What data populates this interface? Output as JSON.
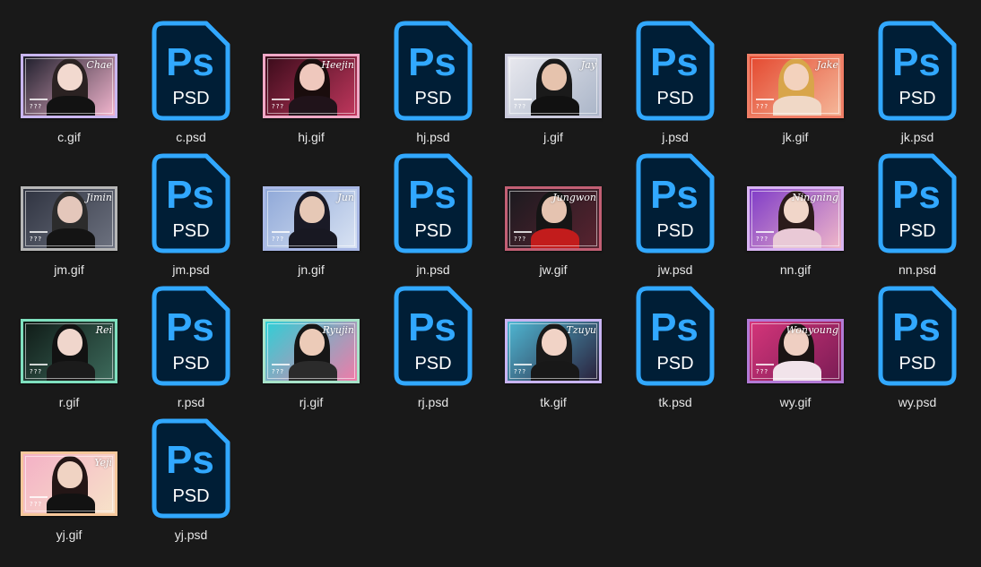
{
  "files": [
    {
      "name": "c.gif",
      "type": "gif",
      "script": "Chae",
      "frame": "#c9b6f0",
      "bg1": "#1d1d2a",
      "bg2": "#f3b6cf",
      "skin": "#f2d9cf",
      "hair": "#2b2222",
      "cloth": "#121212"
    },
    {
      "name": "c.psd",
      "type": "psd",
      "icon": "photoshop-psd-icon"
    },
    {
      "name": "hj.gif",
      "type": "gif",
      "script": "Heejin",
      "frame": "#f0a8c6",
      "bg1": "#3a0b1a",
      "bg2": "#c0375d",
      "skin": "#efc8bd",
      "hair": "#1a0d0d",
      "cloth": "#20131a"
    },
    {
      "name": "hj.psd",
      "type": "psd",
      "icon": "photoshop-psd-icon"
    },
    {
      "name": "j.gif",
      "type": "gif",
      "script": "Jay",
      "frame": "#c9c9dc",
      "bg1": "#e9e9ef",
      "bg2": "#aab5c8",
      "skin": "#e6c3ad",
      "hair": "#1a1a1a",
      "cloth": "#111111"
    },
    {
      "name": "j.psd",
      "type": "psd",
      "icon": "photoshop-psd-icon"
    },
    {
      "name": "jk.gif",
      "type": "gif",
      "script": "Jake",
      "frame": "#f07e66",
      "bg1": "#e4482f",
      "bg2": "#f5b89a",
      "skin": "#f3d2bd",
      "hair": "#d8a54a",
      "cloth": "#f0d8c6"
    },
    {
      "name": "jk.psd",
      "type": "psd",
      "icon": "photoshop-psd-icon"
    },
    {
      "name": "jm.gif",
      "type": "gif",
      "script": "Jimin",
      "frame": "#b7b7b7",
      "bg1": "#2f3340",
      "bg2": "#6d7280",
      "skin": "#e4c7bb",
      "hair": "#2c2c2c",
      "cloth": "#141414"
    },
    {
      "name": "jm.psd",
      "type": "psd",
      "icon": "photoshop-psd-icon"
    },
    {
      "name": "jn.gif",
      "type": "gif",
      "script": "Jun",
      "frame": "#a9b8e6",
      "bg1": "#8fa8d8",
      "bg2": "#d9e3f3",
      "skin": "#e6c8b6",
      "hair": "#1a1a26",
      "cloth": "#181822"
    },
    {
      "name": "jn.psd",
      "type": "psd",
      "icon": "photoshop-psd-icon"
    },
    {
      "name": "jw.gif",
      "type": "gif",
      "script": "Jungwon",
      "frame": "#c25f74",
      "bg1": "#1a1a1f",
      "bg2": "#5a2330",
      "skin": "#e5c3b0",
      "hair": "#151515",
      "cloth": "#c21c1c"
    },
    {
      "name": "jw.psd",
      "type": "psd",
      "icon": "photoshop-psd-icon"
    },
    {
      "name": "nn.gif",
      "type": "gif",
      "script": "Ningning",
      "frame": "#d8b4f2",
      "bg1": "#7f3bc8",
      "bg2": "#f0b7c9",
      "skin": "#f1d6c9",
      "hair": "#2b1b1b",
      "cloth": "#e9c9d6"
    },
    {
      "name": "nn.psd",
      "type": "psd",
      "icon": "photoshop-psd-icon"
    },
    {
      "name": "r.gif",
      "type": "gif",
      "script": "Rei",
      "frame": "#7fe0bf",
      "bg1": "#0f1a16",
      "bg2": "#3d6b5c",
      "skin": "#f0d6cc",
      "hair": "#121212",
      "cloth": "#1b1b1b"
    },
    {
      "name": "r.psd",
      "type": "psd",
      "icon": "photoshop-psd-icon"
    },
    {
      "name": "rj.gif",
      "type": "gif",
      "script": "Ryujin",
      "frame": "#a7e3c9",
      "bg1": "#2fcfd6",
      "bg2": "#f07ba8",
      "skin": "#eccbb8",
      "hair": "#161616",
      "cloth": "#2b2b2b"
    },
    {
      "name": "rj.psd",
      "type": "psd",
      "icon": "photoshop-psd-icon"
    },
    {
      "name": "tk.gif",
      "type": "gif",
      "script": "Tzuyu",
      "frame": "#c9b4f2",
      "bg1": "#4fb7d3",
      "bg2": "#2a1f3a",
      "skin": "#f1d3c6",
      "hair": "#1a1a1a",
      "cloth": "#181818"
    },
    {
      "name": "tk.psd",
      "type": "psd",
      "icon": "photoshop-psd-icon"
    },
    {
      "name": "wy.gif",
      "type": "gif",
      "script": "Wonyoung",
      "frame": "#b27ad6",
      "bg1": "#d5357a",
      "bg2": "#7a1c55",
      "skin": "#efcfc2",
      "hair": "#1b1414",
      "cloth": "#f1e3ea"
    },
    {
      "name": "wy.psd",
      "type": "psd",
      "icon": "photoshop-psd-icon"
    },
    {
      "name": "yj.gif",
      "type": "gif",
      "script": "Yeji",
      "frame": "#f6c79b",
      "bg1": "#f4b0c6",
      "bg2": "#f7e3c9",
      "skin": "#f0d3c3",
      "hair": "#241616",
      "cloth": "#121212"
    },
    {
      "name": "yj.psd",
      "type": "psd",
      "icon": "photoshop-psd-icon"
    }
  ],
  "psd_icon": {
    "letters": "Ps",
    "caption": "PSD",
    "outline_color": "#31a8ff",
    "fill_color": "#001e36"
  },
  "gif_placeholder": "???"
}
